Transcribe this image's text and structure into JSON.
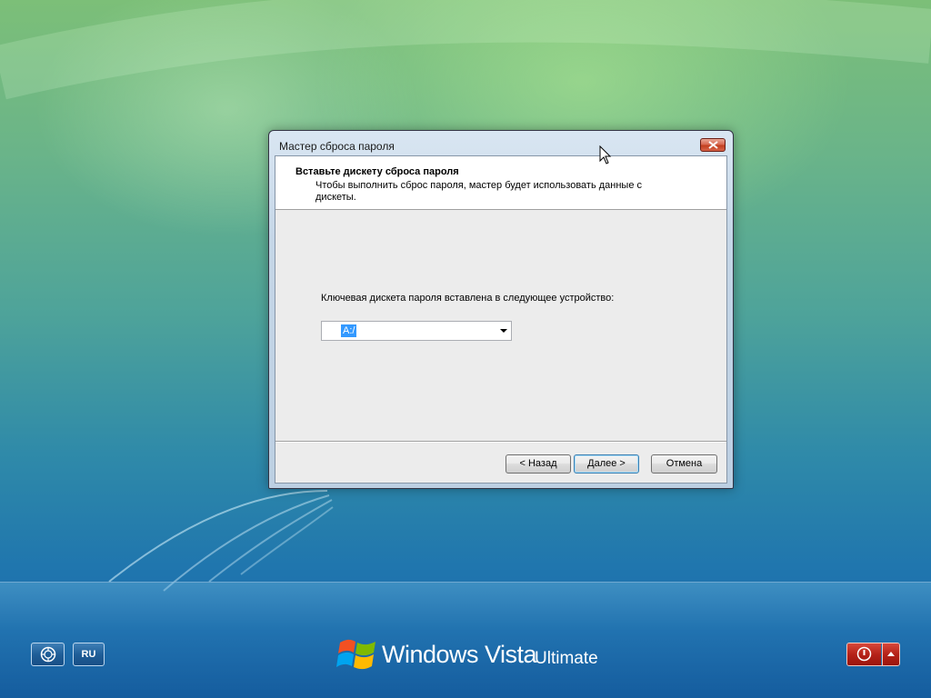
{
  "dialog": {
    "title": "Мастер сброса пароля",
    "header_title": "Вставьте дискету сброса пароля",
    "header_description": "Чтобы выполнить сброс пароля, мастер будет использовать данные с дискеты.",
    "field_label": "Ключевая дискета пароля вставлена в следующее устройство:",
    "device_select": {
      "selected": "A:/"
    },
    "buttons": {
      "back": "< Назад",
      "next": "Далее >",
      "cancel": "Отмена"
    }
  },
  "logon": {
    "ease_of_access_icon": "ease-of-access-icon",
    "language": "RU",
    "brand_windows": "Windows Vista",
    "brand_edition": "Ultimate",
    "power_icon": "power-icon",
    "power_options_icon": "up-arrow-icon"
  },
  "colors": {
    "wallpaper_top": "#7cbf78",
    "wallpaper_bottom": "#1c6ba8",
    "selection": "#3399ff",
    "power_red": "#b52218"
  }
}
